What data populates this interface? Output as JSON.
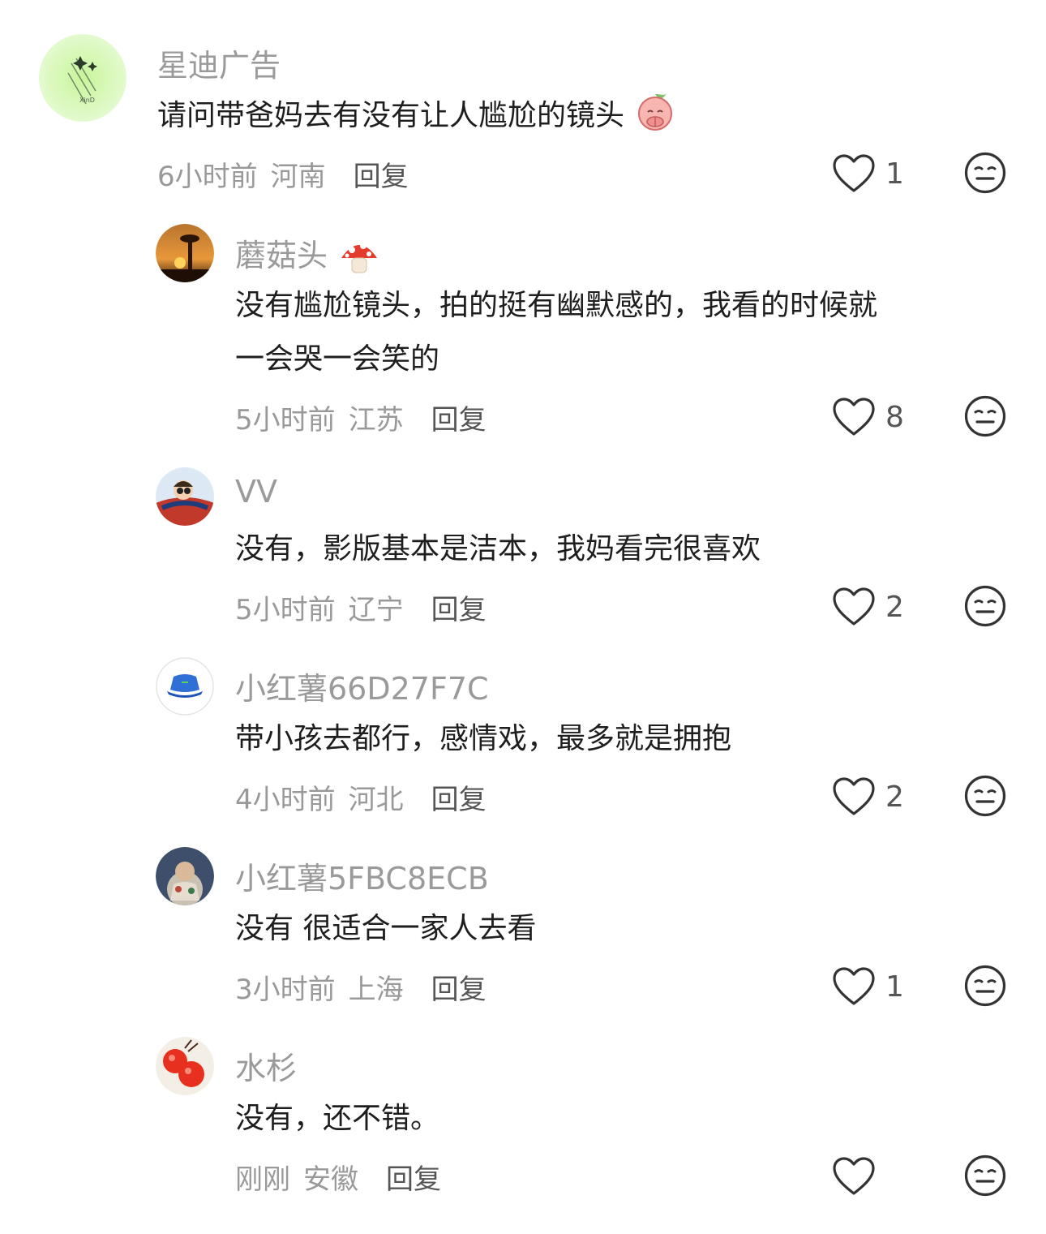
{
  "comments": [
    {
      "username": "星迪广告",
      "text_lines": [
        "请问带爸妈去有没有让人尴尬的镜头"
      ],
      "inline_emoji": "peach-praying-emoji",
      "time": "6小时前",
      "region": "河南",
      "reply_label": "回复",
      "likes": "1"
    },
    {
      "username": "蘑菇头",
      "username_emoji": "mushroom-emoji",
      "text_lines": [
        "没有尴尬镜头，拍的挺有幽默感的，我看的时候就",
        "一会哭一会笑的"
      ],
      "time": "5小时前",
      "region": "江苏",
      "reply_label": "回复",
      "likes": "8"
    },
    {
      "username": "VV",
      "text_lines": [
        "没有，影版基本是洁本，我妈看完很喜欢"
      ],
      "time": "5小时前",
      "region": "辽宁",
      "reply_label": "回复",
      "likes": "2"
    },
    {
      "username": "小红薯66D27F7C",
      "text_lines": [
        "带小孩去都行，感情戏，最多就是拥抱"
      ],
      "time": "4小时前",
      "region": "河北",
      "reply_label": "回复",
      "likes": "2"
    },
    {
      "username": "小红薯5FBC8ECB",
      "text_lines": [
        "没有 很适合一家人去看"
      ],
      "time": "3小时前",
      "region": "上海",
      "reply_label": "回复",
      "likes": "1"
    },
    {
      "username": "水杉",
      "text_lines": [
        "没有，还不错。"
      ],
      "time": "刚刚",
      "region": "安徽",
      "reply_label": "回复",
      "likes": ""
    }
  ],
  "icons": {
    "like": "heart-outline-icon",
    "dislike": "neutral-face-icon"
  },
  "colors": {
    "username": "#9a9a9a",
    "meta": "#999999",
    "text": "#1e1e1e",
    "icon": "#333333"
  }
}
